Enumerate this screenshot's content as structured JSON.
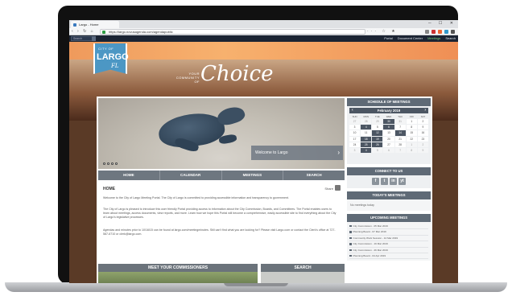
{
  "browser": {
    "tab_title": "Largo - Home",
    "url": "https://largo.novusagenda.com/agendapublic",
    "window_controls": "─ ☐ ✕",
    "nav_buttons": "‹ › ↻ ⌂",
    "addr_extras": "··· ☆ ★"
  },
  "site_topbar": {
    "search_placeholder": "Search",
    "nav": [
      "Portal",
      "Document Center",
      "Meetings",
      "Search"
    ]
  },
  "header": {
    "logo_small": "CITY OF",
    "logo_big": "LARGO",
    "logo_fl": "FL",
    "tagline_small": "YOUR COMMUNITY OF",
    "tagline_big": "Choice"
  },
  "hero": {
    "caption": "Welcome to Largo",
    "arrow": "›"
  },
  "main_nav": [
    "HOME",
    "CALENDAR",
    "MEETINGS",
    "SEARCH"
  ],
  "home": {
    "heading": "HOME",
    "share_label": "Share",
    "paragraphs": [
      "Welcome to the City of Largo Meeting Portal. The City of Largo is committed to providing accessible information and transparency to government.",
      "The City of Largo is pleased to introduce this user friendly Portal providing access to information about the City Commission, Boards, and Committees. The Portal enables users to learn about meetings, access documents, view reports, and more. Learn how we hope this Portal will become a comprehensive, easily accessible site to find everything about the City of Largo's legislative processes.",
      "Agendas and minutes prior to 10/16/15 can be found at largo.com/meetingminutes. Still can't find what you are looking for? Please visit Largo.com or contact the Clerk's office at 727-587-6710 or clerk@largo.com."
    ]
  },
  "bottom_blocks": {
    "commissioners": "MEET YOUR COMMISSIONERS",
    "search": "SEARCH"
  },
  "sidebar": {
    "schedule_title": "SCHEDULE OF MEETINGS",
    "calendar": {
      "month": "February 2019",
      "prev": "‹",
      "next": "›",
      "dow": [
        "SUN",
        "MON",
        "TUE",
        "WED",
        "THU",
        "FRI",
        "SAT"
      ],
      "days": [
        {
          "d": "27",
          "t": "other"
        },
        {
          "d": "28",
          "t": "other"
        },
        {
          "d": "29",
          "t": "other"
        },
        {
          "d": "30",
          "t": "event"
        },
        {
          "d": "31",
          "t": "other"
        },
        {
          "d": "1",
          "t": ""
        },
        {
          "d": "2",
          "t": ""
        },
        {
          "d": "3",
          "t": ""
        },
        {
          "d": "4",
          "t": "event"
        },
        {
          "d": "5",
          "t": ""
        },
        {
          "d": "6",
          "t": "event"
        },
        {
          "d": "7",
          "t": ""
        },
        {
          "d": "8",
          "t": ""
        },
        {
          "d": "9",
          "t": ""
        },
        {
          "d": "10",
          "t": ""
        },
        {
          "d": "11",
          "t": ""
        },
        {
          "d": "12",
          "t": "event"
        },
        {
          "d": "13",
          "t": ""
        },
        {
          "d": "14",
          "t": "event"
        },
        {
          "d": "15",
          "t": ""
        },
        {
          "d": "16",
          "t": ""
        },
        {
          "d": "17",
          "t": ""
        },
        {
          "d": "18",
          "t": "event"
        },
        {
          "d": "19",
          "t": "event"
        },
        {
          "d": "20",
          "t": ""
        },
        {
          "d": "21",
          "t": ""
        },
        {
          "d": "22",
          "t": ""
        },
        {
          "d": "23",
          "t": ""
        },
        {
          "d": "24",
          "t": ""
        },
        {
          "d": "25",
          "t": "event"
        },
        {
          "d": "26",
          "t": "event"
        },
        {
          "d": "27",
          "t": ""
        },
        {
          "d": "28",
          "t": ""
        },
        {
          "d": "1",
          "t": "other"
        },
        {
          "d": "2",
          "t": "other"
        },
        {
          "d": "3",
          "t": "other"
        },
        {
          "d": "4",
          "t": "event"
        },
        {
          "d": "5",
          "t": "other"
        },
        {
          "d": "6",
          "t": "other"
        },
        {
          "d": "7",
          "t": "other"
        },
        {
          "d": "8",
          "t": "other"
        },
        {
          "d": "9",
          "t": "other"
        }
      ]
    },
    "connect_title": "CONNECT TO US",
    "social": [
      "f",
      "t",
      "in",
      "yt"
    ],
    "today_title": "TODAY'S MEETINGS",
    "today_text": "No meetings today",
    "upcoming_title": "UPCOMING MEETINGS",
    "upcoming": [
      "City Commission - 05 Mar 2019",
      "Planning Board - 07 Mar 2019",
      "Community Work Session - 12 Mar 2019",
      "City Commission - 19 Mar 2019",
      "City Commission - 26 Mar 2019",
      "Planning Board - 04 Apr 2019"
    ]
  }
}
